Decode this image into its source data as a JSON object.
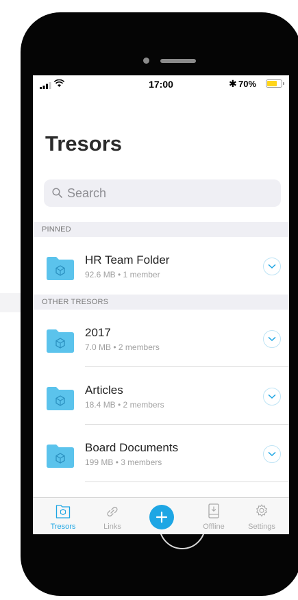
{
  "status_bar": {
    "time": "17:00",
    "battery_text": "70%",
    "battery_level": 0.7,
    "bluetooth_icon": "bluetooth-icon"
  },
  "header": {
    "title": "Tresors"
  },
  "search": {
    "placeholder": "Search"
  },
  "sections": {
    "pinned": {
      "label": "PINNED",
      "items": [
        {
          "name": "HR Team Folder",
          "meta": "92.6 MB • 1 member"
        }
      ]
    },
    "other": {
      "label": "OTHER TRESORS",
      "items": [
        {
          "name": "2017",
          "meta": "7.0 MB • 2 members"
        },
        {
          "name": "Articles",
          "meta": "18.4 MB • 2 members"
        },
        {
          "name": "Board Documents",
          "meta": "199 MB • 3 members"
        }
      ]
    }
  },
  "tab_bar": {
    "tabs": [
      {
        "label": "Tresors",
        "icon": "tresor-folder-icon",
        "active": true
      },
      {
        "label": "Links",
        "icon": "link-icon"
      },
      {
        "label": "",
        "icon": "plus-icon"
      },
      {
        "label": "Offline",
        "icon": "offline-download-icon"
      },
      {
        "label": "Settings",
        "icon": "gear-icon"
      }
    ]
  },
  "colors": {
    "accent": "#1ea6e4",
    "folder": "#5bc3ec",
    "battery": "#ffd51a"
  }
}
